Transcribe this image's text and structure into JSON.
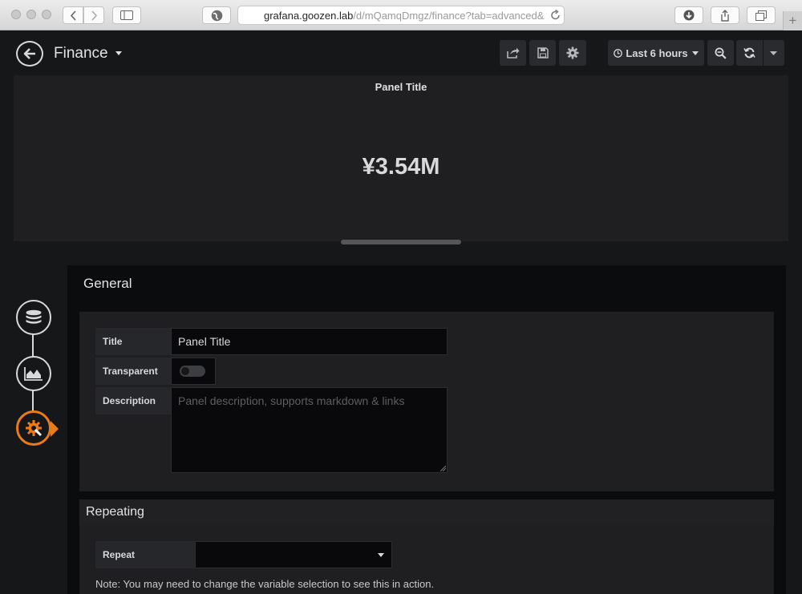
{
  "browser": {
    "url_host": "grafana.goozen.lab",
    "url_path": "/d/mQamqDmgz/finance?tab=advanced&",
    "new_tab_label": "+"
  },
  "nav": {
    "dashboard_title": "Finance",
    "time_picker_label": "Last 6 hours"
  },
  "panel": {
    "title": "Panel Title",
    "stat_value": "¥3.54M"
  },
  "editor": {
    "general_heading": "General",
    "title_label": "Title",
    "title_value": "Panel Title",
    "transparent_label": "Transparent",
    "transparent_on": false,
    "description_label": "Description",
    "description_placeholder": "Panel description, supports markdown & links",
    "repeating_heading": "Repeating",
    "repeat_label": "Repeat",
    "repeat_value": "",
    "note": "Note: You may need to change the variable selection to see this in action."
  },
  "colors": {
    "accent": "#eb7b18",
    "background": "#161719",
    "panel": "#1f1f21"
  },
  "icons": [
    "back-arrow-icon",
    "share-icon",
    "save-icon",
    "gear-icon",
    "clock-icon",
    "zoom-out-icon",
    "refresh-icon",
    "database-icon",
    "area-chart-icon",
    "settings-wrench-icon"
  ]
}
